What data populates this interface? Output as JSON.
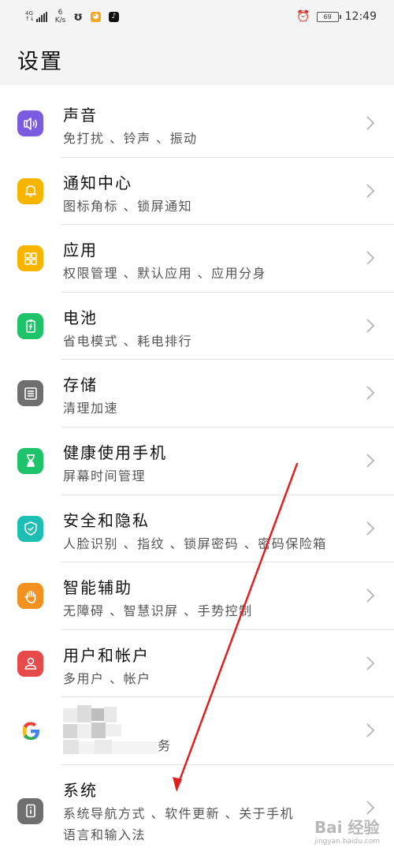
{
  "status_bar": {
    "network": "4G",
    "speed_value": "6",
    "speed_unit": "K/s",
    "battery": "69",
    "time": "12:49"
  },
  "header": {
    "title": "设置"
  },
  "items": [
    {
      "title": "声音",
      "sub": "免打扰 、铃声 、振动",
      "icon": "sound-icon",
      "color": "#7b5be0"
    },
    {
      "title": "通知中心",
      "sub": "图标角标 、锁屏通知",
      "icon": "bell-icon",
      "color": "#f7b500"
    },
    {
      "title": "应用",
      "sub": "权限管理 、默认应用 、应用分身",
      "icon": "apps-grid-icon",
      "color": "#f7b500"
    },
    {
      "title": "电池",
      "sub": "省电模式 、耗电排行",
      "icon": "battery-icon",
      "color": "#1ec36a"
    },
    {
      "title": "存储",
      "sub": "清理加速",
      "icon": "storage-icon",
      "color": "#6f6f6f"
    },
    {
      "title": "健康使用手机",
      "sub": "屏幕时间管理",
      "icon": "hourglass-icon",
      "color": "#1ec36a"
    },
    {
      "title": "安全和隐私",
      "sub": "人脸识别 、指纹 、锁屏密码 、密码保险箱",
      "icon": "shield-icon",
      "color": "#1dbfb4"
    },
    {
      "title": "智能辅助",
      "sub": "无障碍 、智慧识屏 、手势控制",
      "icon": "hand-icon",
      "color": "#f29020"
    },
    {
      "title": "用户和帐户",
      "sub": "多用户 、帐户",
      "icon": "user-icon",
      "color": "#e64a4a"
    },
    {
      "title": "",
      "sub": "务",
      "icon": "google-icon",
      "color": "#ffffff"
    },
    {
      "title": "系统",
      "sub": "系统导航方式 、软件更新 、关于手机",
      "sub2": "语言和输入法",
      "icon": "system-info-icon",
      "color": "#6f6f6f"
    }
  ],
  "watermark": {
    "text": "Bai 经验",
    "url": "jingyan.baidu.com"
  }
}
